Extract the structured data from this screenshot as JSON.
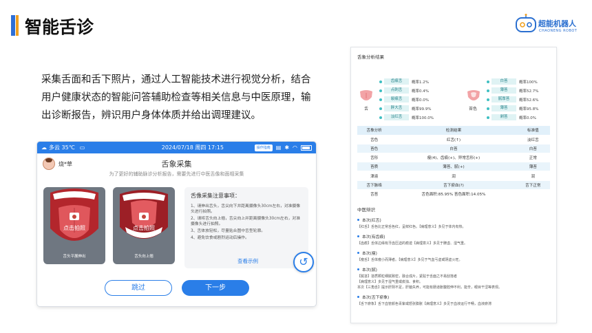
{
  "slide": {
    "title": "智能舌诊",
    "intro": "采集舌面和舌下照片，通过人工智能技术进行视觉分析，结合用户健康状态的智能问答辅助检查等相关信息与中医原理，输出诊断报告，辨识用户身体体质并给出调理建议。",
    "brand": {
      "name": "超能机器人",
      "sub": "CHAONENG ROBOT"
    }
  },
  "tablet": {
    "status": {
      "weather": "多云 35℃",
      "datetime": "2024/07/18 周四   17:15",
      "guide_btn": "操作指南"
    },
    "user_name": "烧*草",
    "screen_title": "舌象采集",
    "screen_subtitle": "为了更好的辅助脉诊分析报告，需要先进行中医舌像和面相采集",
    "cards": [
      {
        "action": "点击拍照",
        "caption": "舌头平展伸出"
      },
      {
        "action": "点击拍照",
        "caption": "舌头向上翘"
      }
    ],
    "notes": {
      "title": "舌像采集注意事项：",
      "items": [
        "1、请伸出舌头，舌尖向下并距离摄像头30cm左右，对准摄像头进行拍照。",
        "2、请将舌头向上翘，舌尖向上并距离摄像头30cm左右，对准摄像头进行拍照。",
        "3、舌体放轻松，尽量贴合图中舌型轮廓。",
        "4、避免饮食或剧烈运动后操作。"
      ],
      "link": "查看示例"
    },
    "skip_label": "跳过",
    "next_label": "下一步"
  },
  "report": {
    "title": "舌象分析结果",
    "tongue_label": "舌",
    "coating_label": "苔色",
    "left_metrics": [
      {
        "tag": "齿痕舌",
        "val": "概率1.2%"
      },
      {
        "tag": "点刺舌",
        "val": "概率0.4%"
      },
      {
        "tag": "裂痕舌",
        "val": "概率0.0%"
      },
      {
        "tag": "胖大舌",
        "val": "概率99.9%"
      },
      {
        "tag": "淡红舌",
        "val": "概率100.0%"
      }
    ],
    "right_metrics": [
      {
        "tag": "白苔",
        "val": "概率100%"
      },
      {
        "tag": "薄苔",
        "val": "概率52.7%"
      },
      {
        "tag": "腻厚苔",
        "val": "概率52.6%"
      },
      {
        "tag": "薄苔",
        "val": "概率95.8%"
      },
      {
        "tag": "剥苔",
        "val": "概率0.0%"
      }
    ],
    "table": {
      "headers": [
        "舌象分析",
        "检测结果",
        "标准值"
      ],
      "rows": [
        [
          "舌色",
          "红舌(↑)",
          "淡红舌"
        ],
        [
          "苔色",
          "白苔",
          "白苔"
        ],
        [
          "舌形",
          "瘦(4)、齿痕(+)、异常舌形(+)",
          "正常"
        ],
        [
          "苔质",
          "薄苔、腻(+)",
          "薄苔"
        ],
        [
          "津液",
          "润",
          "润"
        ],
        [
          "舌下脉络",
          "舌下瘀血(?)",
          "舌下正常"
        ],
        [
          "舌苔",
          "舌色面积:85.95%    苔色面积:14.05%",
          ""
        ]
      ]
    },
    "tcm": {
      "title": "中医辩识",
      "sections": [
        {
          "heading": "本次(红舌)",
          "lines": [
            "【红舌】舌色比正常舌色红，呈鲜红色。【病理意义】多见于体内有热。"
          ]
        },
        {
          "heading": "本次(有齿痕)",
          "lines": [
            "【齿痕】舌体边缘有牙齿压迫的痕迹【病理意义】多见于脾虚、湿气重。"
          ]
        },
        {
          "heading": "本次(瘦)",
          "lines": [
            "【瘦舌】舌体瘦小而薄者。【病理意义】多见于气血亏虚或阴虚火旺。"
          ]
        },
        {
          "heading": "本次(腻)",
          "lines": [
            "【腻苔】苔质颗粒细腻致密，融合成片，紧贴于舌面之不易刮落者",
            "【病理意义】多见于湿气重或痰浊、食积。",
            "本次【三角舌】提示肝阴不足，肝脑失养，可能有肠道胀腹腔伸不利，能辛，眼目干涩等表现。"
          ]
        },
        {
          "heading": "本次(舌下瘀象)",
          "lines": [
            "【舌下瘀象】舌下血管颜色青紫或怒张膨胀【病理意义】多见于血液运行不畅，血液瘀滞"
          ]
        }
      ]
    }
  }
}
